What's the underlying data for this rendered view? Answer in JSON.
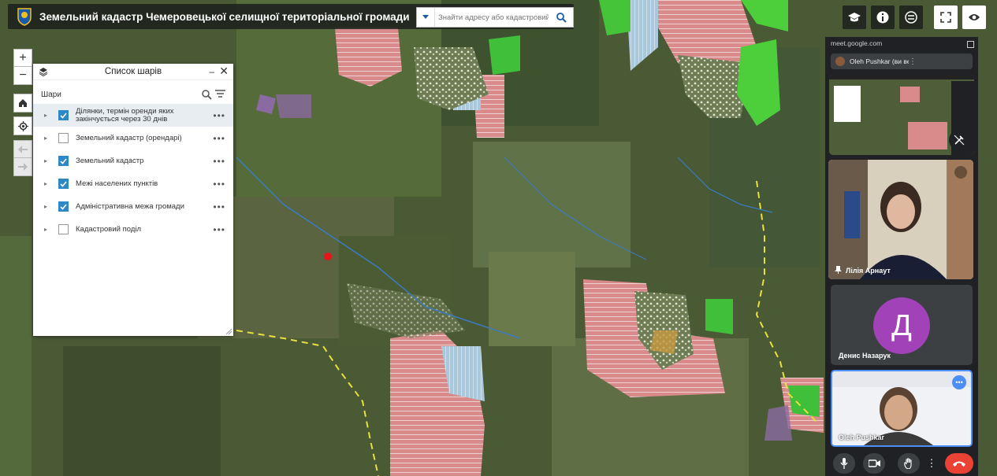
{
  "header": {
    "title": "Земельний кадастр Чемеровецької селищної територіальної громади",
    "search_placeholder": "Знайти адресу або кадастровий н"
  },
  "toolbar": {
    "icons": [
      "graduation-cap-icon",
      "info-icon",
      "layers-share-icon",
      "fullscreen-icon",
      "eye-icon"
    ]
  },
  "map_controls": {
    "zoom_in": "+",
    "zoom_out": "−"
  },
  "layer_panel": {
    "title": "Список шарів",
    "section_label": "Шари",
    "layers": [
      {
        "label": "Ділянки, термін оренди яких закінчується через 30 днів",
        "checked": true
      },
      {
        "label": "Земельний кадастр (орендарі)",
        "checked": false
      },
      {
        "label": "Земельний кадастр",
        "checked": true
      },
      {
        "label": "Межі населених пунктів",
        "checked": true
      },
      {
        "label": "Адміністративна межа громади",
        "checked": true
      },
      {
        "label": "Кадастровий поділ",
        "checked": false
      }
    ]
  },
  "meet": {
    "url": "meet.google.com",
    "presenting": "Oleh Pushkar (ви ведете презен...",
    "participants": [
      {
        "name": "Лілія Арнаут"
      },
      {
        "name": "Денис Назарук",
        "initial": "Д"
      },
      {
        "name": "Oleh Pushkar"
      }
    ]
  },
  "colors": {
    "accent": "#2f88c6",
    "avatar": "#a142b8",
    "end_call": "#ea4335",
    "header_bg": "#1c201c"
  }
}
